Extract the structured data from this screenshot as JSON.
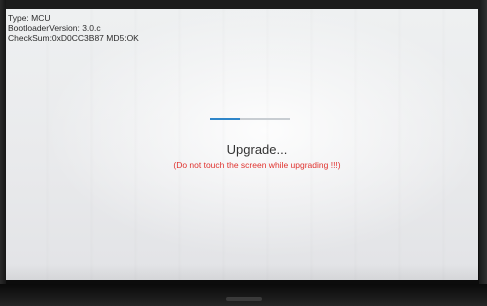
{
  "info": {
    "type_line": "Type: MCU",
    "bootloader_line": "BootloaderVersion:  3.0.c",
    "checksum_line": "CheckSum:0xD0CC3B87 MD5:OK"
  },
  "progress": {
    "fraction": 0.38,
    "fill_color": "#2f86c9",
    "track_color": "#c8cdd2"
  },
  "status": {
    "title": "Upgrade...",
    "warning": "(Do not touch the screen while upgrading !!!)",
    "warning_color": "#e0322e"
  }
}
